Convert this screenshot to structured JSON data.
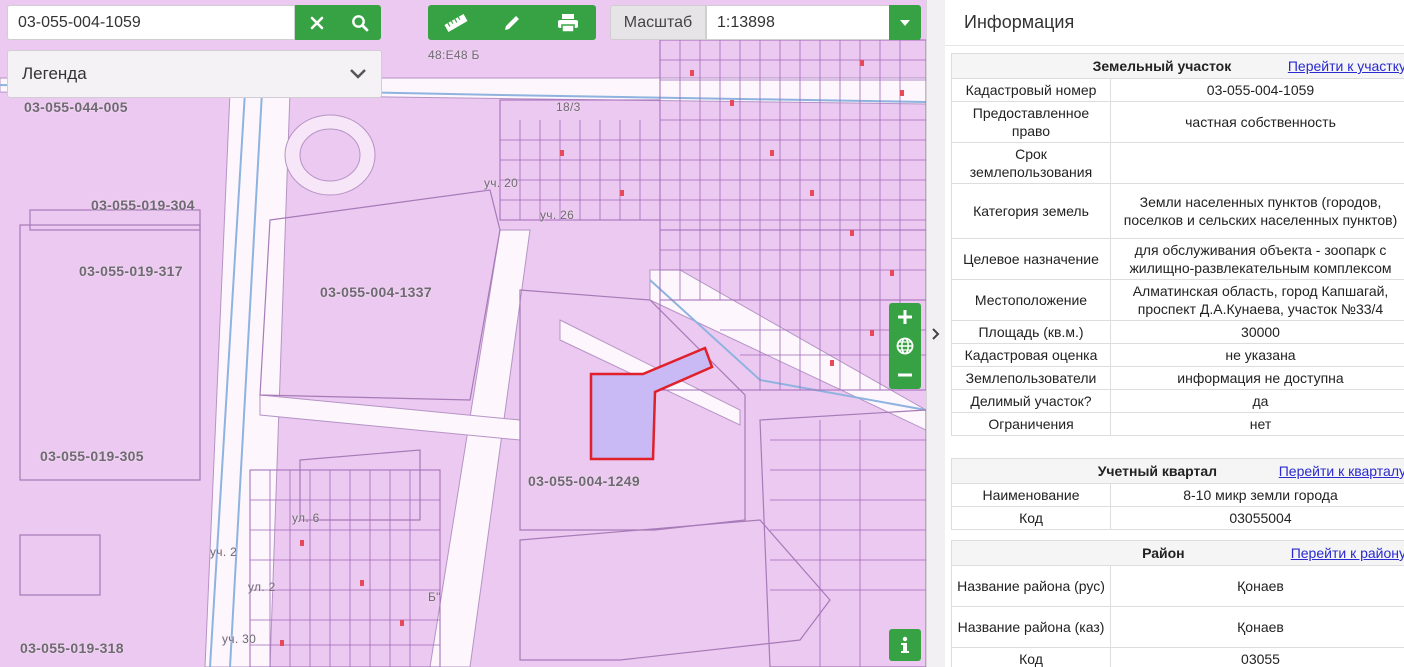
{
  "search": {
    "value": "03-055-004-1059"
  },
  "scale": {
    "label": "Масштаб",
    "value": "1:13898"
  },
  "legend": {
    "label": "Легенда"
  },
  "map_labels": [
    "03-055-044-005",
    "03-055-019-304",
    "03-055-019-317",
    "03-055-004-1337",
    "03-055-019-305",
    "03-055-004-1249",
    "03-055-019-318",
    "48:Е48 Б",
    "18/3",
    "уч. 20",
    "уч. 26",
    "ул. 6",
    "уч. 2",
    "Б\"",
    "ул. 2",
    "уч. 30"
  ],
  "colors": {
    "accent": "#37a244",
    "parcel_fill": "#ecc9f0",
    "highlight_border": "#e0202a",
    "highlight_fill": "#c9b9f5",
    "link": "#2a2ad0"
  },
  "panel": {
    "title": "Информация",
    "sections": [
      {
        "header": "Земельный участок",
        "link": "Перейти к участку",
        "rows": [
          {
            "k": "Кадастровый номер",
            "v": "03-055-004-1059"
          },
          {
            "k": "Предоставленное право",
            "v": "частная собственность"
          },
          {
            "k": "Срок землепользования",
            "v": ""
          },
          {
            "k": "Категория земель",
            "v": "Земли населенных пунктов (городов, поселков и сельских населенных пунктов)"
          },
          {
            "k": "Целевое назначение",
            "v": "для обслуживания объекта - зоопарк с жилищно-развлекательным комплексом"
          },
          {
            "k": "Местоположение",
            "v": "Алматинская область, город Капшагай, проспект Д.А.Кунаева, участок №33/4"
          },
          {
            "k": "Площадь (кв.м.)",
            "v": "30000"
          },
          {
            "k": "Кадастровая оценка",
            "v": "не указана"
          },
          {
            "k": "Землепользователи",
            "v": "информация не доступна"
          },
          {
            "k": "Делимый участок?",
            "v": "да"
          },
          {
            "k": "Ограничения",
            "v": "нет"
          }
        ]
      },
      {
        "header": "Учетный квартал",
        "link": "Перейти к кварталу",
        "rows": [
          {
            "k": "Наименование",
            "v": "8-10 микр земли города"
          },
          {
            "k": "Код",
            "v": "03055004"
          }
        ]
      },
      {
        "header": "Район",
        "link": "Перейти к району",
        "rows": [
          {
            "k": "Название района (рус)",
            "v": "Қонаев"
          },
          {
            "k": "Название района (каз)",
            "v": "Қонаев"
          },
          {
            "k": "Код",
            "v": "03055"
          }
        ]
      }
    ]
  }
}
